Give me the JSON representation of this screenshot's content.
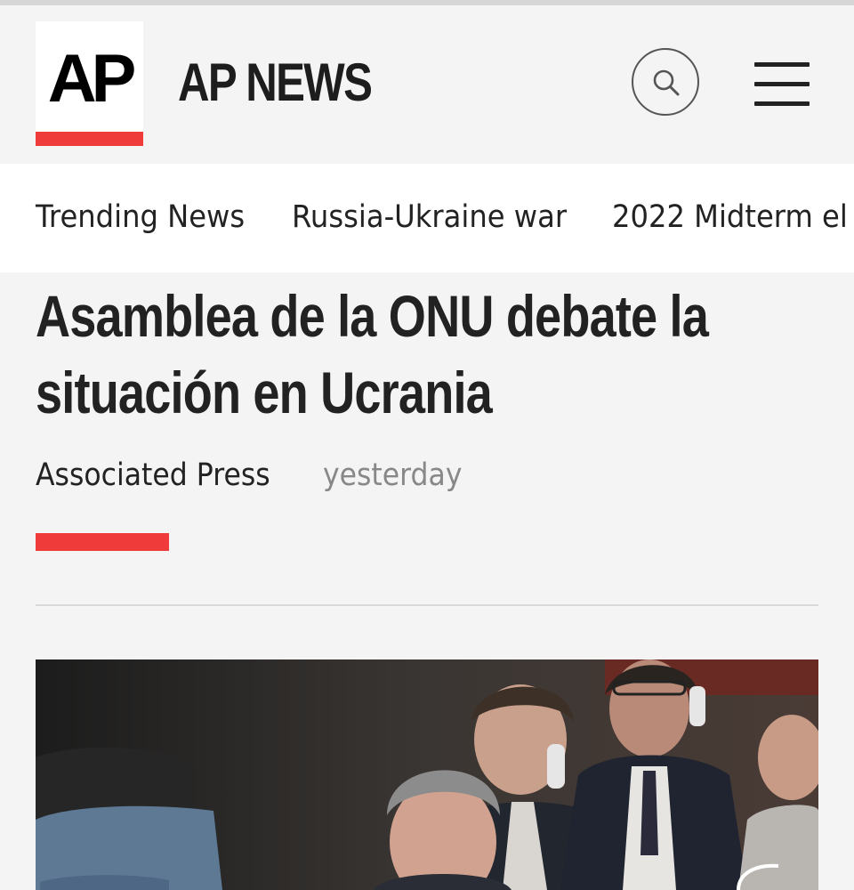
{
  "header": {
    "logo_text": "AP",
    "site_name": "AP NEWS",
    "icons": {
      "search": "search-icon",
      "menu": "hamburger-menu-icon"
    },
    "accent_color": "#ef3b39"
  },
  "nav": {
    "items": [
      {
        "label": "Trending News"
      },
      {
        "label": "Russia-Ukraine war"
      },
      {
        "label": "2022 Midterm el"
      }
    ]
  },
  "article": {
    "headline_line1": "Asamblea de la ONU debate la",
    "headline_line2": "situación en Ucrania",
    "author": "Associated Press",
    "published": "yesterday",
    "image_description": "photo"
  }
}
